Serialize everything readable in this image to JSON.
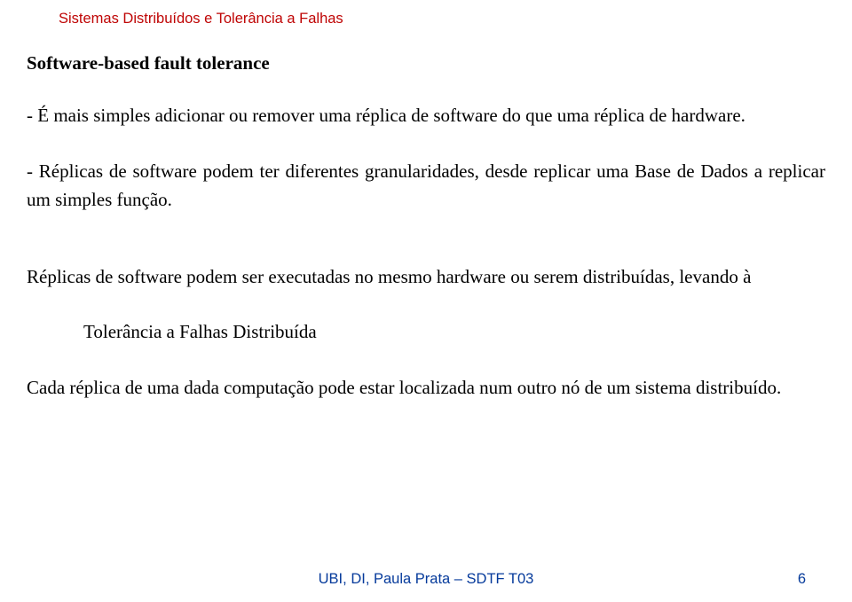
{
  "header": "Sistemas Distribuídos e Tolerância a Falhas",
  "title": "Software-based fault tolerance",
  "para1": " - É mais simples adicionar ou remover uma réplica de software do que uma réplica de hardware.",
  "para2": " - Réplicas de software podem ter diferentes granularidades, desde replicar uma Base de Dados a replicar um simples função.",
  "para3": "Réplicas de software podem ser executadas no mesmo hardware ou serem distribuídas, levando à",
  "indent": "Tolerância a Falhas Distribuída",
  "para4": " Cada réplica de uma dada computação pode estar localizada num outro nó de um sistema distribuído.",
  "footer_text": "UBI, DI, Paula Prata – SDTF T03",
  "footer_page": "6"
}
